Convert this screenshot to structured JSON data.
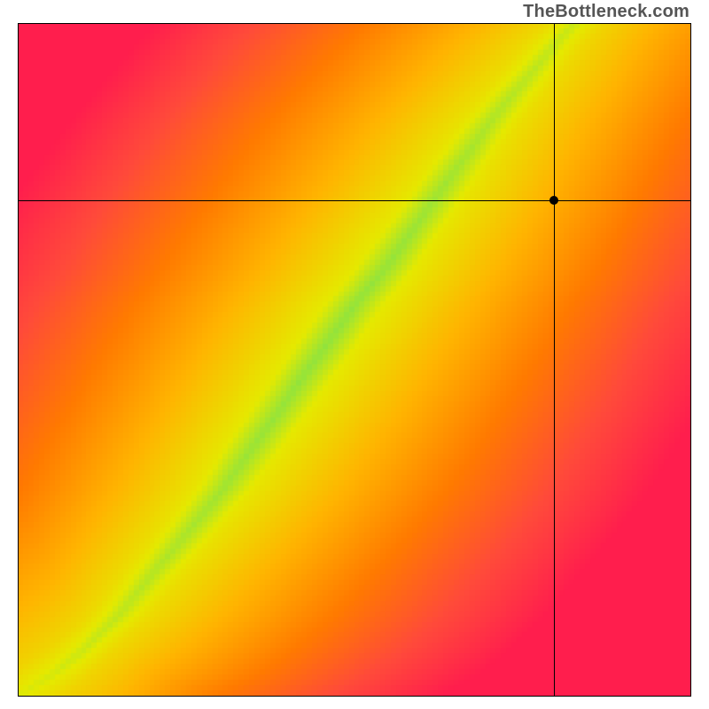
{
  "watermark": "TheBottleneck.com",
  "chart_data": {
    "type": "heatmap",
    "title": "",
    "xlabel": "",
    "ylabel": "",
    "xlim": [
      0,
      1
    ],
    "ylim": [
      0,
      1
    ],
    "grid": false,
    "legend": false,
    "crosshair": {
      "x": 0.797,
      "y": 0.738
    },
    "marker": {
      "x": 0.797,
      "y": 0.738
    },
    "optimal_curve": {
      "description": "Green ridge of optimal pairing; values are (x, y) in normalized axis units from bottom-left origin.",
      "points": [
        [
          0.0,
          0.0
        ],
        [
          0.05,
          0.03
        ],
        [
          0.1,
          0.07
        ],
        [
          0.15,
          0.12
        ],
        [
          0.2,
          0.18
        ],
        [
          0.25,
          0.24
        ],
        [
          0.3,
          0.3
        ],
        [
          0.35,
          0.37
        ],
        [
          0.4,
          0.44
        ],
        [
          0.45,
          0.51
        ],
        [
          0.5,
          0.58
        ],
        [
          0.55,
          0.64
        ],
        [
          0.6,
          0.71
        ],
        [
          0.65,
          0.78
        ],
        [
          0.7,
          0.85
        ],
        [
          0.75,
          0.91
        ],
        [
          0.8,
          0.97
        ],
        [
          0.83,
          1.0
        ]
      ]
    },
    "ridge_half_width": 0.045,
    "color_stops": {
      "description": "Color as a function of |distance from ridge| / max_distance, 0 = on ridge.",
      "stops": [
        {
          "t": 0.0,
          "color": "#00e28a"
        },
        {
          "t": 0.1,
          "color": "#7fe24a"
        },
        {
          "t": 0.22,
          "color": "#e5e900"
        },
        {
          "t": 0.4,
          "color": "#ffb400"
        },
        {
          "t": 0.6,
          "color": "#ff7a00"
        },
        {
          "t": 0.8,
          "color": "#ff4a3a"
        },
        {
          "t": 1.0,
          "color": "#ff1e4d"
        }
      ]
    },
    "pixelation": 128
  }
}
